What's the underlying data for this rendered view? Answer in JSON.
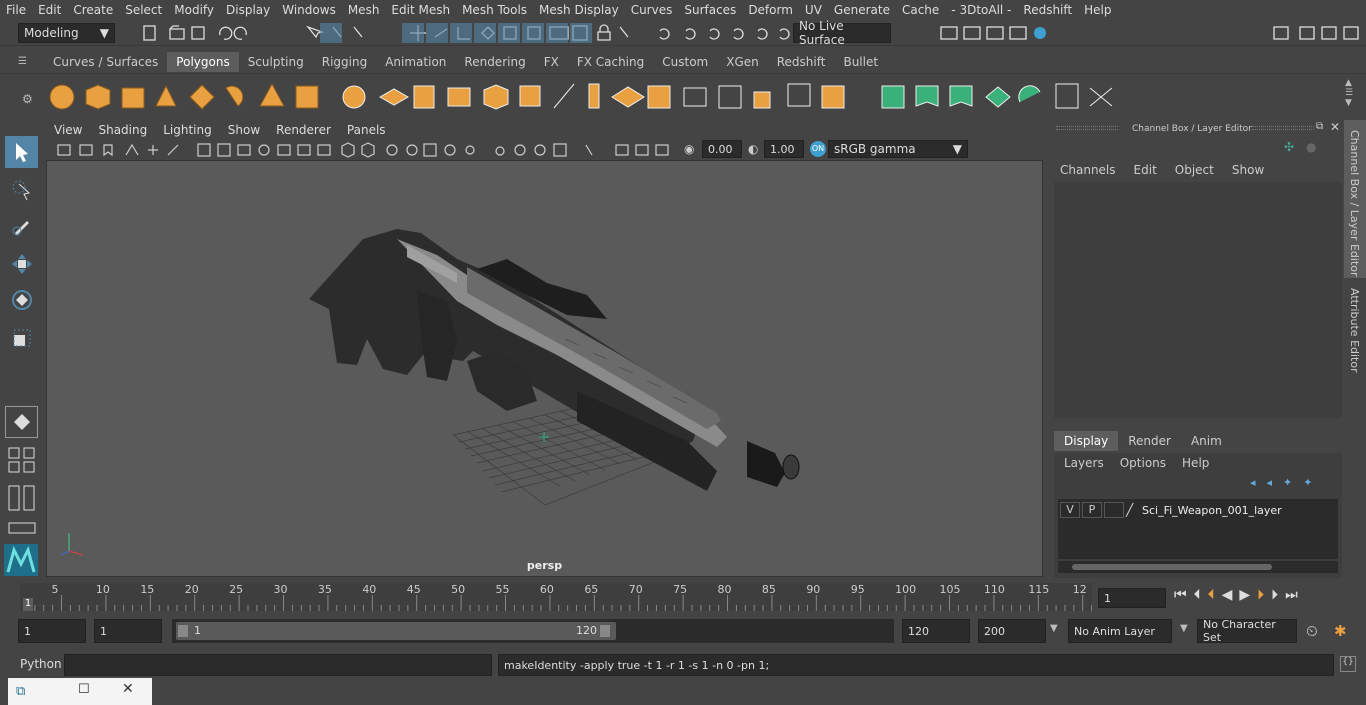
{
  "menus": [
    "File",
    "Edit",
    "Create",
    "Select",
    "Modify",
    "Display",
    "Windows",
    "Mesh",
    "Edit Mesh",
    "Mesh Tools",
    "Mesh Display",
    "Curves",
    "Surfaces",
    "Deform",
    "UV",
    "Generate",
    "Cache",
    "- 3DtoAll -",
    "Redshift",
    "Help"
  ],
  "status": {
    "mode": "Modeling",
    "live_surface": "No Live Surface"
  },
  "shelf_tabs": [
    "Curves / Surfaces",
    "Polygons",
    "Sculpting",
    "Rigging",
    "Animation",
    "Rendering",
    "FX",
    "FX Caching",
    "Custom",
    "XGen",
    "Redshift",
    "Bullet"
  ],
  "active_shelf": "Polygons",
  "viewport": {
    "menus": [
      "View",
      "Shading",
      "Lighting",
      "Show",
      "Renderer",
      "Panels"
    ],
    "exposure": "0.00",
    "gamma": "1.00",
    "color_space": "sRGB gamma",
    "camera": "persp"
  },
  "channel_box": {
    "title": "Channel Box / Layer Editor",
    "menus": [
      "Channels",
      "Edit",
      "Object",
      "Show"
    ]
  },
  "layer_editor": {
    "tabs": [
      "Display",
      "Render",
      "Anim"
    ],
    "active_tab": "Display",
    "menus": [
      "Layers",
      "Options",
      "Help"
    ],
    "layer": {
      "v": "V",
      "p": "P",
      "name": "Sci_Fi_Weapon_001_layer"
    }
  },
  "side_tabs": [
    "Channel Box / Layer Editor",
    "Attribute Editor"
  ],
  "timeline": {
    "ticks": [
      "5",
      "10",
      "15",
      "20",
      "25",
      "30",
      "35",
      "40",
      "45",
      "50",
      "55",
      "60",
      "65",
      "70",
      "75",
      "80",
      "85",
      "90",
      "95",
      "100",
      "105",
      "110",
      "115",
      "12"
    ],
    "start_marker": "1",
    "current_frame": "1"
  },
  "range": {
    "start": "1",
    "current": "1",
    "range_start": "1",
    "range_end_label": "120",
    "end": "120",
    "max": "200",
    "anim_layer": "No Anim Layer",
    "char_set": "No Character Set"
  },
  "command": {
    "lang": "Python",
    "output": "makeIdentity -apply true -t 1 -r 1 -s 1 -n 0 -pn 1;"
  },
  "colors": {
    "accent": "#5285a6",
    "bg": "#444444",
    "viewport": "#5a5a5a",
    "shelf_icon": "#e8a040",
    "green_icon": "#3ab07a"
  }
}
